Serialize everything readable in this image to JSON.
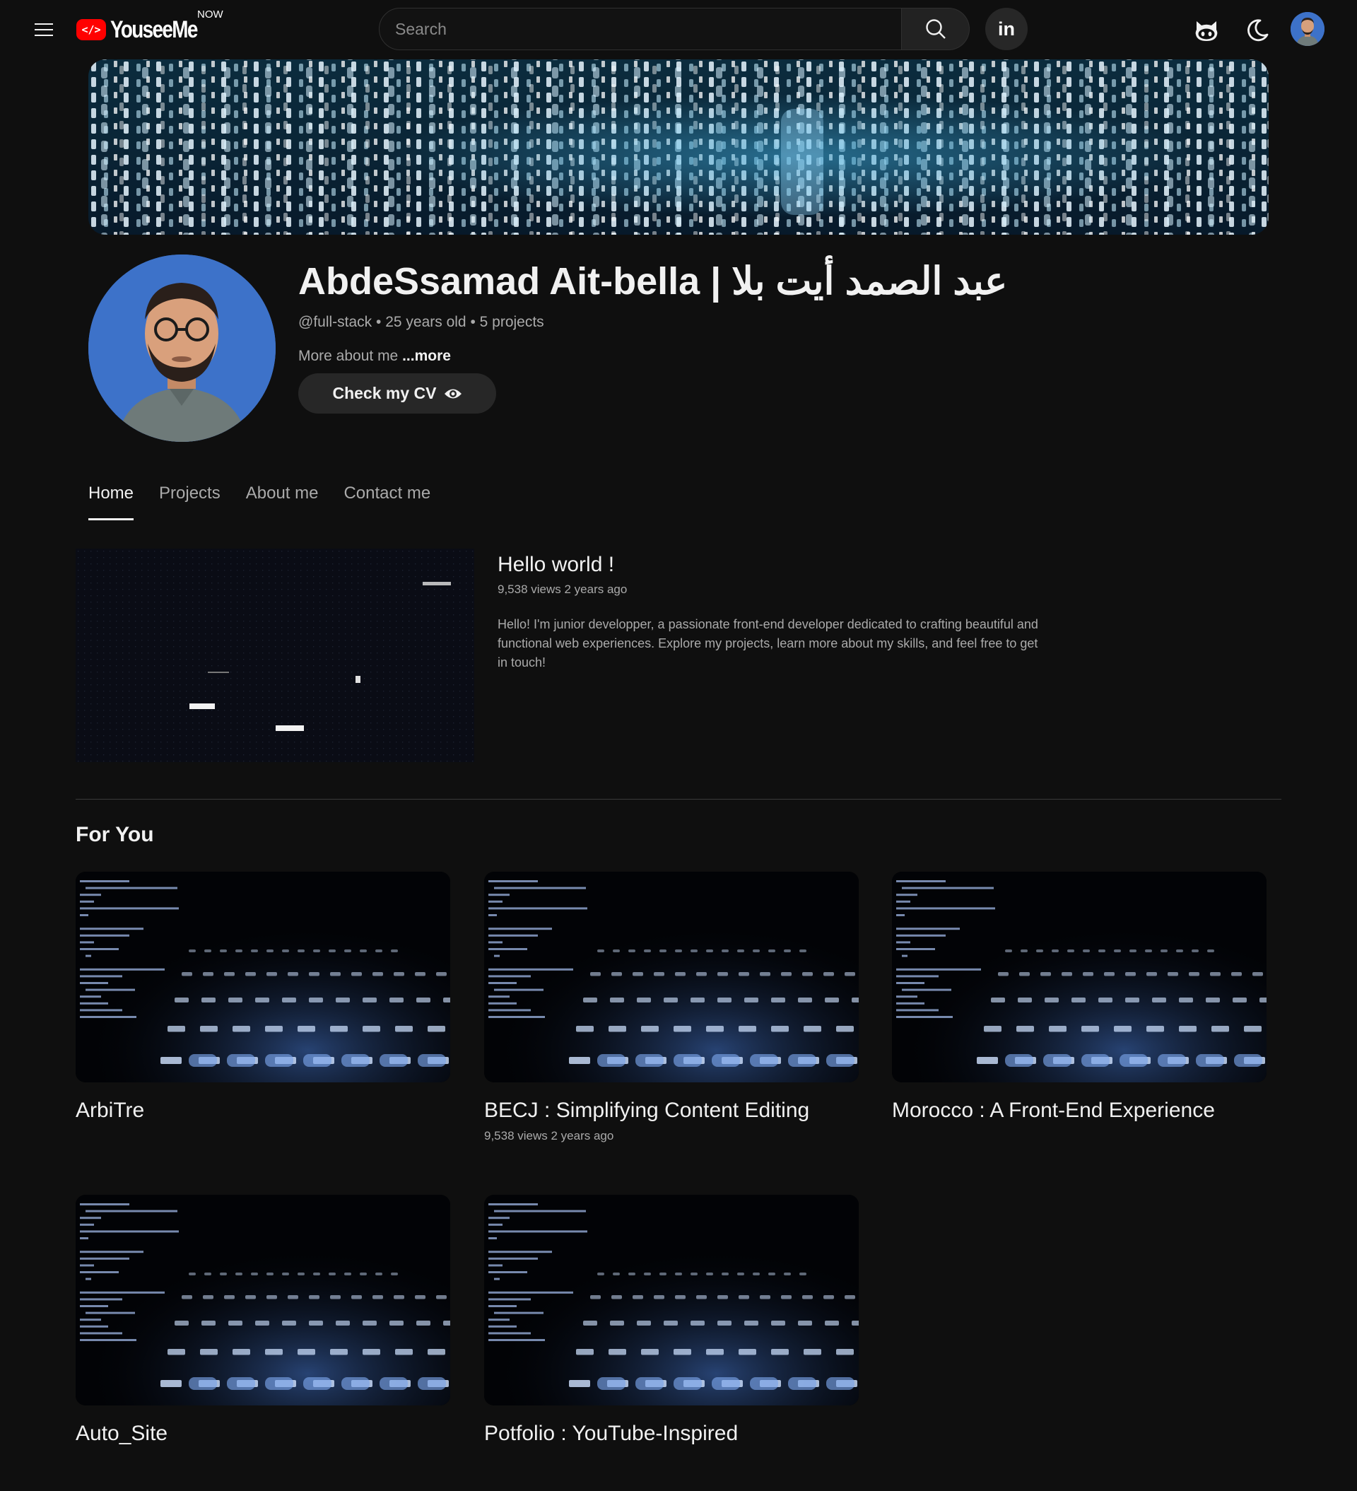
{
  "header": {
    "logo_text": "YouseeMe",
    "logo_badge": "NOW",
    "search_placeholder": "Search",
    "linkedin_label": "in"
  },
  "profile": {
    "name": "AbdeSsamad Ait-bella | عبد الصمد أيت بلا",
    "handle": "@full-stack",
    "age": "25 years old",
    "projects": "5 projects",
    "meta_sep": " • ",
    "about_prefix": "More about me ",
    "about_more": "...more",
    "cv_button": "Check my CV"
  },
  "tabs": [
    {
      "label": "Home",
      "active": true
    },
    {
      "label": "Projects",
      "active": false
    },
    {
      "label": "About me",
      "active": false
    },
    {
      "label": "Contact me",
      "active": false
    }
  ],
  "featured": {
    "title": "Hello world !",
    "meta": "9,538 views 2 years ago",
    "description": "Hello! I'm junior developper, a passionate front-end developer dedicated to crafting beautiful and functional web experiences. Explore my projects, learn more about my skills, and feel free to get in touch!"
  },
  "for_you": {
    "title": "For You",
    "cards": [
      {
        "title": "ArbiTre",
        "meta": ""
      },
      {
        "title": "BECJ : Simplifying Content Editing",
        "meta": "9,538 views 2 years ago"
      },
      {
        "title": "Morocco : A Front-End Experience",
        "meta": ""
      },
      {
        "title": "Auto_Site",
        "meta": ""
      },
      {
        "title": "Potfolio : YouTube-Inspired",
        "meta": ""
      }
    ]
  },
  "colors": {
    "background": "#0f0f0f",
    "brand_red": "#ff0000",
    "text_primary": "#f1f1f1",
    "text_secondary": "#aaaaaa",
    "chip": "#272727"
  },
  "icons": {
    "menu": "hamburger-menu-icon",
    "search": "search-icon",
    "github": "github-icon",
    "theme": "moon-icon",
    "cv": "eye-icon"
  }
}
